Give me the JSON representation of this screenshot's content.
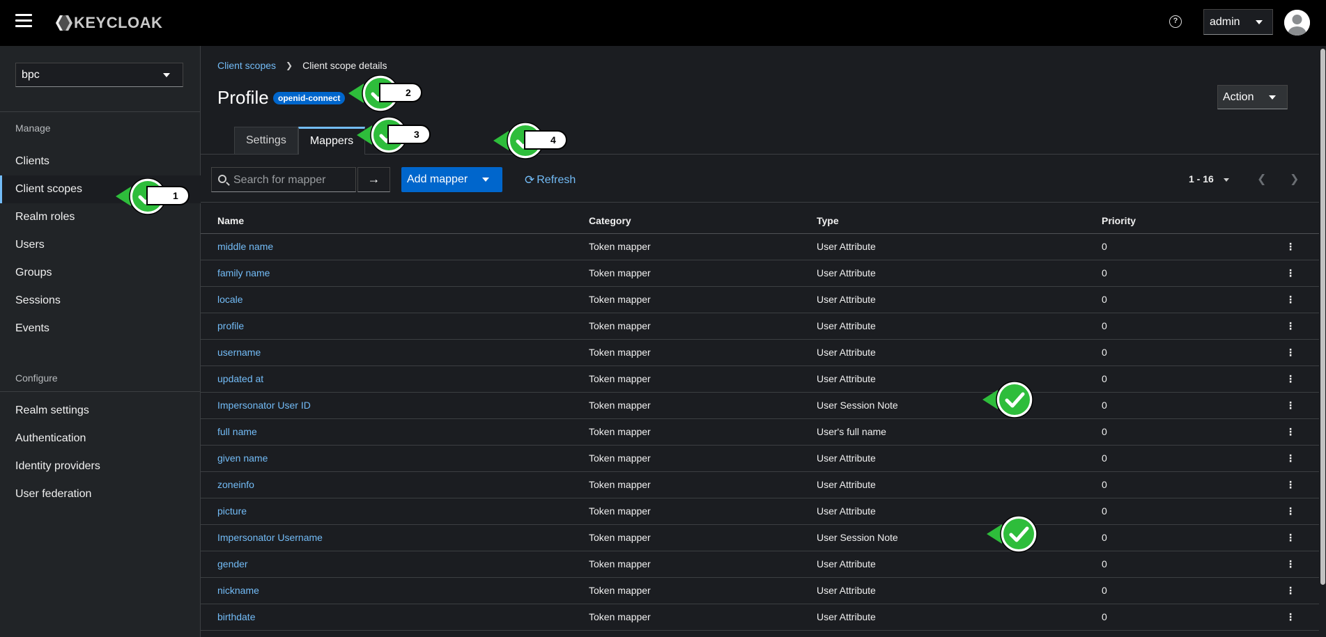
{
  "header": {
    "logo_text": "KEYCLOAK",
    "help_icon_glyph": "?",
    "user": "admin"
  },
  "sidebar": {
    "realm": "bpc",
    "manage_label": "Manage",
    "manage_items": [
      {
        "label": "Clients"
      },
      {
        "label": "Client scopes"
      },
      {
        "label": "Realm roles"
      },
      {
        "label": "Users"
      },
      {
        "label": "Groups"
      },
      {
        "label": "Sessions"
      },
      {
        "label": "Events"
      }
    ],
    "configure_label": "Configure",
    "configure_items": [
      {
        "label": "Realm settings"
      },
      {
        "label": "Authentication"
      },
      {
        "label": "Identity providers"
      },
      {
        "label": "User federation"
      }
    ]
  },
  "breadcrumb": {
    "parent": "Client scopes",
    "current": "Client scope details"
  },
  "page": {
    "title": "Profile",
    "badge": "openid-connect",
    "action_label": "Action"
  },
  "tabs": [
    {
      "label": "Settings"
    },
    {
      "label": "Mappers"
    }
  ],
  "toolbar": {
    "search_placeholder": "Search for mapper",
    "add_mapper_label": "Add mapper",
    "refresh_label": "Refresh",
    "pagination": "1 - 16"
  },
  "table": {
    "headers": [
      "Name",
      "Category",
      "Type",
      "Priority"
    ],
    "rows": [
      {
        "name": "middle name",
        "category": "Token mapper",
        "type": "User Attribute",
        "priority": "0"
      },
      {
        "name": "family name",
        "category": "Token mapper",
        "type": "User Attribute",
        "priority": "0"
      },
      {
        "name": "locale",
        "category": "Token mapper",
        "type": "User Attribute",
        "priority": "0"
      },
      {
        "name": "profile",
        "category": "Token mapper",
        "type": "User Attribute",
        "priority": "0"
      },
      {
        "name": "username",
        "category": "Token mapper",
        "type": "User Attribute",
        "priority": "0"
      },
      {
        "name": "updated at",
        "category": "Token mapper",
        "type": "User Attribute",
        "priority": "0"
      },
      {
        "name": "Impersonator User ID",
        "category": "Token mapper",
        "type": "User Session Note",
        "priority": "0"
      },
      {
        "name": "full name",
        "category": "Token mapper",
        "type": "User's full name",
        "priority": "0"
      },
      {
        "name": "given name",
        "category": "Token mapper",
        "type": "User Attribute",
        "priority": "0"
      },
      {
        "name": "zoneinfo",
        "category": "Token mapper",
        "type": "User Attribute",
        "priority": "0"
      },
      {
        "name": "picture",
        "category": "Token mapper",
        "type": "User Attribute",
        "priority": "0"
      },
      {
        "name": "Impersonator Username",
        "category": "Token mapper",
        "type": "User Session Note",
        "priority": "0"
      },
      {
        "name": "gender",
        "category": "Token mapper",
        "type": "User Attribute",
        "priority": "0"
      },
      {
        "name": "nickname",
        "category": "Token mapper",
        "type": "User Attribute",
        "priority": "0"
      },
      {
        "name": "birthdate",
        "category": "Token mapper",
        "type": "User Attribute",
        "priority": "0"
      }
    ]
  },
  "annotations": [
    {
      "label": "1"
    },
    {
      "label": "2"
    },
    {
      "label": "3"
    },
    {
      "label": "4"
    }
  ],
  "colors": {
    "accent": "#73bcf7",
    "primary": "#0066cc",
    "marker_green": "#2ebd3b"
  }
}
